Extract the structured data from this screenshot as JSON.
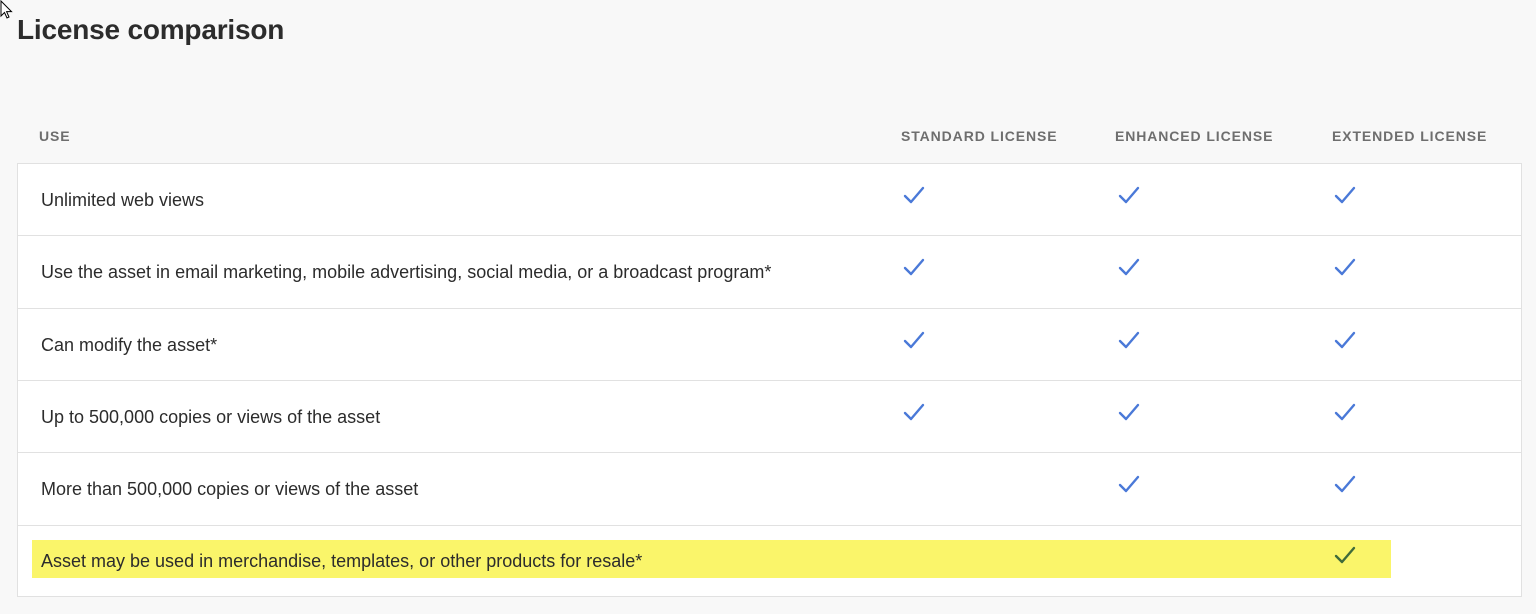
{
  "page": {
    "title": "License comparison"
  },
  "table": {
    "columns": {
      "use": "USE",
      "standard": "STANDARD LICENSE",
      "enhanced": "ENHANCED LICENSE",
      "extended": "EXTENDED LICENSE"
    },
    "rows": [
      {
        "label": "Unlimited web views",
        "standard": true,
        "enhanced": true,
        "extended": true,
        "highlighted": false
      },
      {
        "label": "Use the asset in email marketing, mobile advertising, social media, or a broadcast program*",
        "standard": true,
        "enhanced": true,
        "extended": true,
        "highlighted": false
      },
      {
        "label": "Can modify the asset*",
        "standard": true,
        "enhanced": true,
        "extended": true,
        "highlighted": false
      },
      {
        "label": "Up to 500,000 copies or views of the asset",
        "standard": true,
        "enhanced": true,
        "extended": true,
        "highlighted": false
      },
      {
        "label": "More than 500,000 copies or views of the asset",
        "standard": false,
        "enhanced": true,
        "extended": true,
        "highlighted": false
      },
      {
        "label": "Asset may be used in merchandise, templates, or other products for resale*",
        "standard": false,
        "enhanced": false,
        "extended": true,
        "highlighted": true
      }
    ]
  },
  "icons": {
    "check": "checkmark-icon",
    "cursor": "mouse-pointer-icon"
  },
  "colors": {
    "check": "#4a79d8",
    "check_on_highlight": "#3f6b3a",
    "highlight": "#faf56a",
    "header_text": "#6e6e6e",
    "body_text": "#2c2c2c"
  }
}
